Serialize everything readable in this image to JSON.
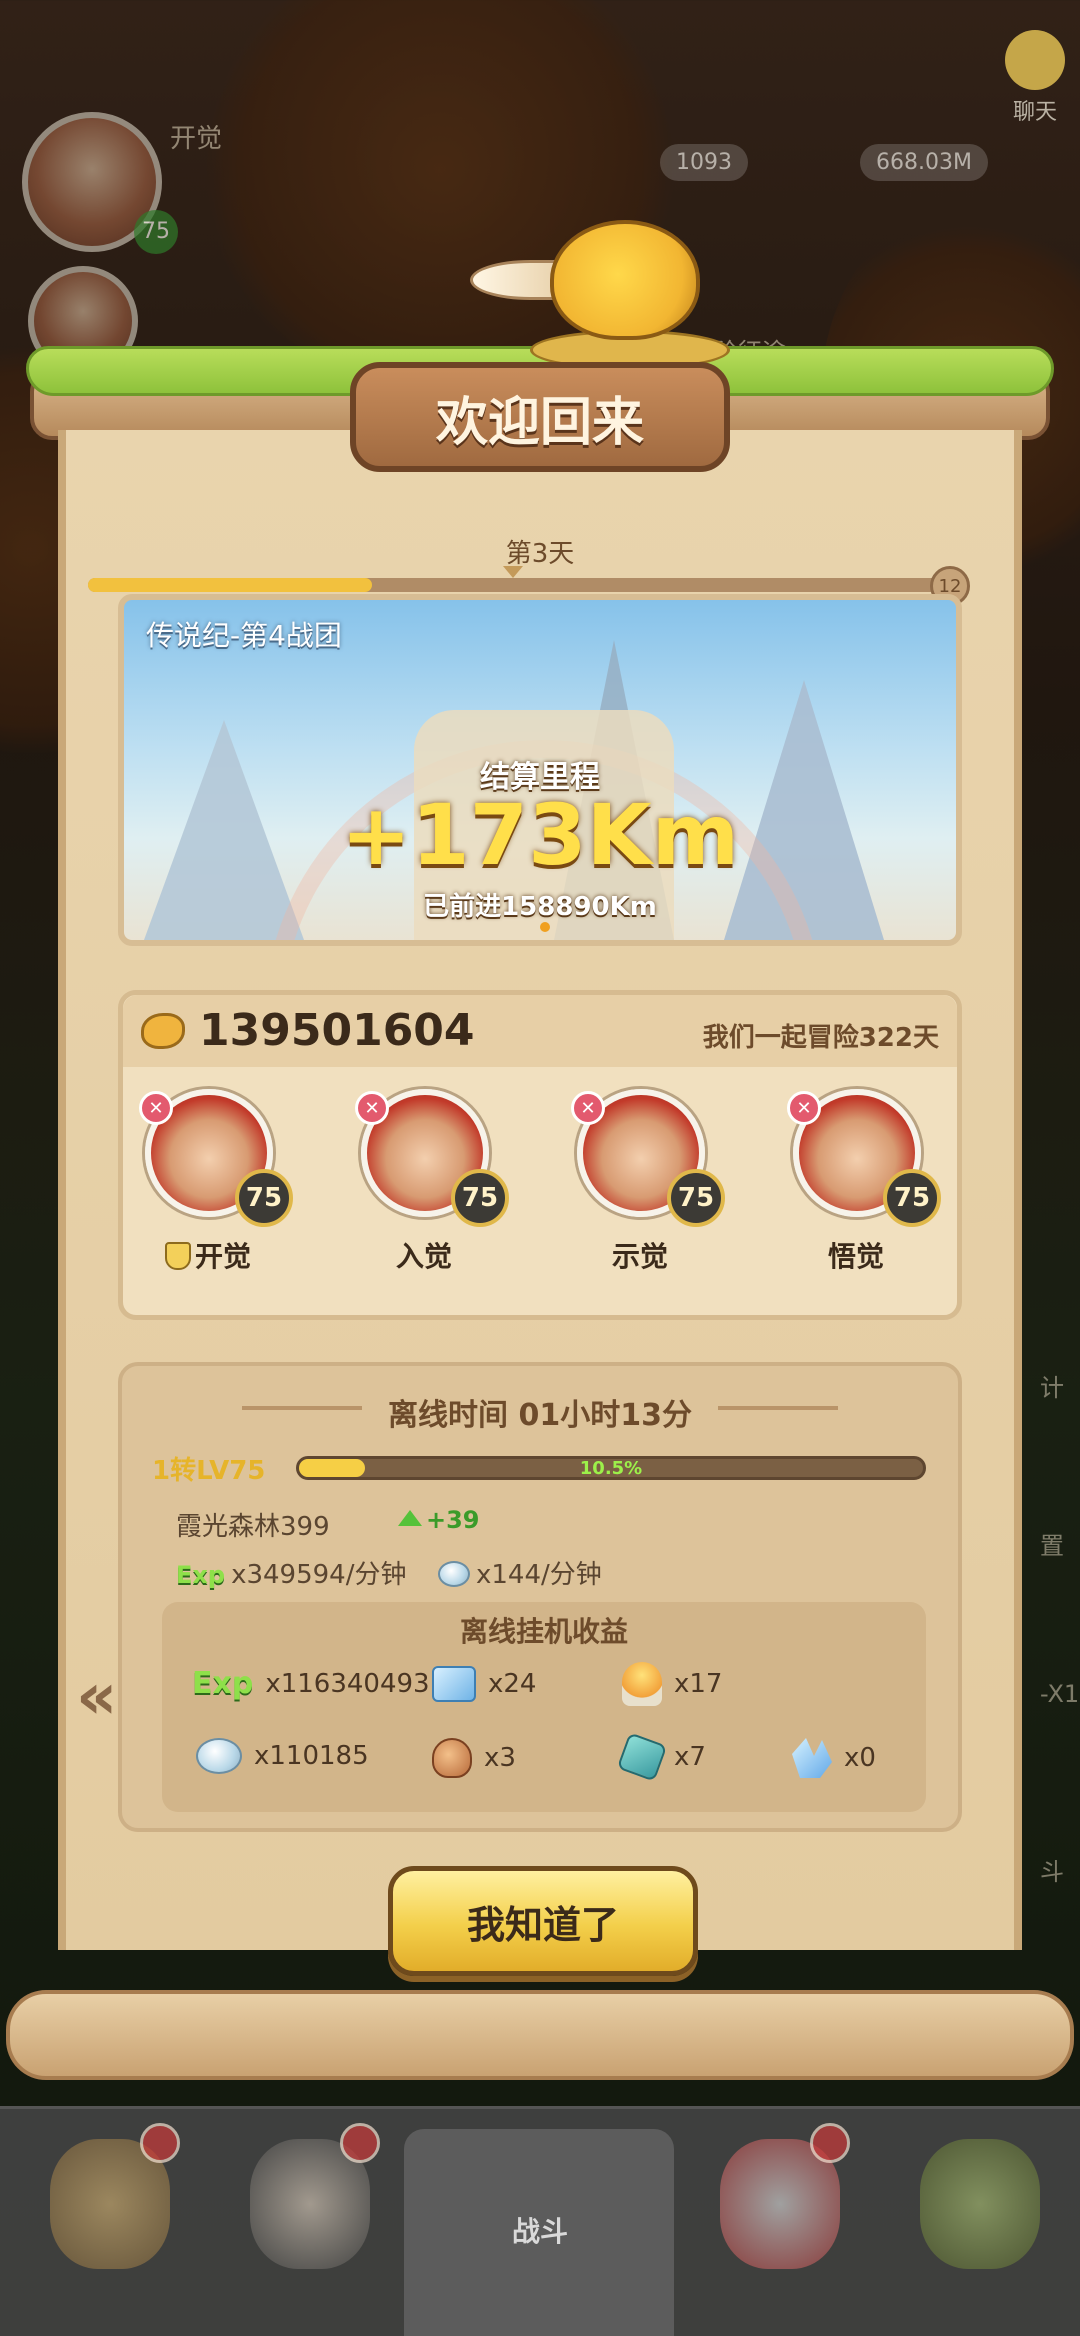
{
  "hud": {
    "chat_label": "聊天",
    "awaken_label": "开觉",
    "level": "75",
    "gold": "1093",
    "crystals": "668.03M",
    "expedition": "冒险征途"
  },
  "side_labels": [
    "计",
    "置",
    "-X1",
    "斗"
  ],
  "dialog": {
    "title": "欢迎回来",
    "day_label": "第3天",
    "day_progress": 0.33,
    "day_max": "12",
    "banner": {
      "stage": "传说纪-第4战团",
      "settle_label": "结算里程",
      "distance": "+173Km",
      "traveled": "已前进158890Km"
    },
    "team": {
      "power": "139501604",
      "adventure_days": "我们一起冒险322天",
      "heroes": [
        {
          "level": "75",
          "name": "开觉"
        },
        {
          "level": "75",
          "name": "入觉"
        },
        {
          "level": "75",
          "name": "示觉"
        },
        {
          "level": "75",
          "name": "悟觉"
        }
      ]
    },
    "offline": {
      "title": "离线时间 01小时13分",
      "level_label": "1转LV75",
      "level_percent": "10.5%",
      "level_fraction": 0.105,
      "zone": "霞光森林399",
      "zone_up": "+39",
      "exp_tag": "Exp",
      "exp_rate": "x349594/分钟",
      "crystal_rate": "x144/分钟",
      "rewards_title": "离线挂机收益",
      "rewards": [
        {
          "icon": "exp-icon",
          "label": "Exp",
          "amount": "x116340493"
        },
        {
          "icon": "ice-block-icon",
          "amount": "x24"
        },
        {
          "icon": "torch-icon",
          "amount": "x17"
        },
        {
          "icon": "crystal-icon",
          "amount": "x110185"
        },
        {
          "icon": "meat-icon",
          "amount": "x3"
        },
        {
          "icon": "gem-icon",
          "amount": "x7"
        },
        {
          "icon": "shard-icon",
          "amount": "x0"
        }
      ]
    },
    "confirm_label": "我知道了"
  },
  "nav": {
    "battle_label": "战斗"
  },
  "colors": {
    "accent": "#f3cf4a",
    "paper": "#e9d4ad",
    "frame": "#6e4426"
  }
}
